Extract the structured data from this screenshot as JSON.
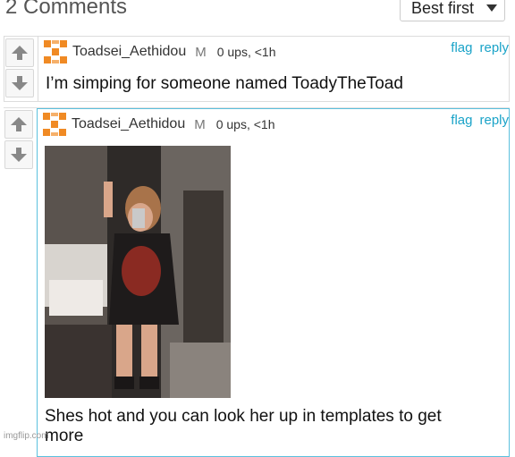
{
  "header": {
    "title": "2 Comments",
    "sort_label": "Best first"
  },
  "comments": [
    {
      "username": "Toadsei_Aethidou",
      "badge": "M",
      "stats": "0 ups, <1h",
      "flag": "flag",
      "reply": "reply",
      "text": "I’m simping for someone named ToadyTheToad"
    },
    {
      "username": "Toadsei_Aethidou",
      "badge": "M",
      "stats": "0 ups, <1h",
      "flag": "flag",
      "reply": "reply",
      "has_image": true,
      "text_line1": "Shes hot and you can look her up in templates to get",
      "text_line2": "more"
    }
  ],
  "watermark": "imgflip.com",
  "colors": {
    "accent": "#1aa3c8",
    "avatar_orange": "#f08a24",
    "selected_border": "#5bc0de"
  },
  "icons": [
    "arrow-up-icon",
    "arrow-down-icon",
    "avatar-icon",
    "chevron-down-icon"
  ]
}
